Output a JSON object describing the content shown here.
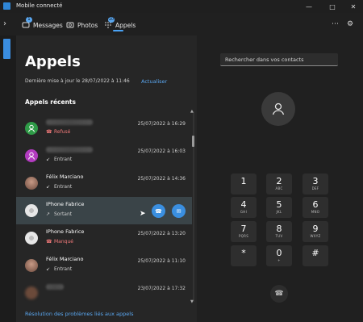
{
  "window": {
    "title": "Mobile connecté"
  },
  "nav": {
    "tabs": [
      {
        "label": "Messages",
        "badge": "1"
      },
      {
        "label": "Photos",
        "badge": ""
      },
      {
        "label": "Appels",
        "badge": "10"
      }
    ],
    "active_tab": "Appels"
  },
  "calls": {
    "title": "Appels",
    "last_update": "Dernière mise à jour le 28/07/2022 à 11:46",
    "refresh_label": "Actualiser",
    "recent_label": "Appels récents",
    "rows": [
      {
        "name": "",
        "status": "Refusé",
        "time": "25/07/2022 à 16:29",
        "avatar_color": "#2e9b47",
        "missed": true
      },
      {
        "name": "",
        "status": "Entrant",
        "time": "25/07/2022 à 16:03",
        "avatar_color": "#b23bbf",
        "missed": false
      },
      {
        "name": "Félix Marciano",
        "status": "Entrant",
        "time": "25/07/2022 à 14:36",
        "avatar_color": "#9a6a55",
        "missed": false
      },
      {
        "name": "IPhone Fabrice",
        "status": "Sortant",
        "time": "",
        "avatar_color": "#d9d9d9",
        "missed": false
      },
      {
        "name": "IPhone Fabrice",
        "status": "Manqué",
        "time": "25/07/2022 à 13:20",
        "avatar_color": "#d9d9d9",
        "missed": true
      },
      {
        "name": "Félix Marciano",
        "status": "Entrant",
        "time": "25/07/2022 à 11:10",
        "avatar_color": "#9a6a55",
        "missed": false
      },
      {
        "name": "",
        "status": "",
        "time": "23/07/2022 à 17:32",
        "avatar_color": "#6b4a3a",
        "missed": false
      }
    ],
    "help_link": "Résolution des problèmes liés aux appels"
  },
  "dialer": {
    "search_placeholder": "Rechercher dans vos contacts",
    "keys": [
      {
        "d": "1",
        "l": ""
      },
      {
        "d": "2",
        "l": "ABC"
      },
      {
        "d": "3",
        "l": "DEF"
      },
      {
        "d": "4",
        "l": "GHI"
      },
      {
        "d": "5",
        "l": "JKL"
      },
      {
        "d": "6",
        "l": "MNO"
      },
      {
        "d": "7",
        "l": "PQRS"
      },
      {
        "d": "8",
        "l": "TUV"
      },
      {
        "d": "9",
        "l": "WXYZ"
      },
      {
        "d": "*",
        "l": ""
      },
      {
        "d": "0",
        "l": "+"
      },
      {
        "d": "#",
        "l": ""
      }
    ]
  },
  "colors": {
    "accent": "#3a8fe0",
    "missed": "#f07979"
  }
}
